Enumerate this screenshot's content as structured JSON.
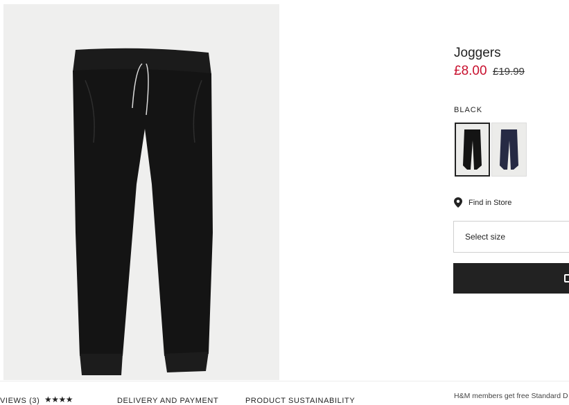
{
  "product": {
    "title": "Joggers",
    "price": "£8.00",
    "old_price": "£19.99",
    "color_label": "BLACK",
    "swatches": [
      {
        "name": "black",
        "color": "#141414",
        "selected": true
      },
      {
        "name": "navy",
        "color": "#262a44",
        "selected": false
      }
    ],
    "find_in_store": "Find in Store",
    "size_select_label": "Select size"
  },
  "colors": {
    "sale": "#c8102e",
    "button": "#222222"
  },
  "bottom_bar": {
    "reviews_label": "VIEWS (3)",
    "rating_stars": "★★★★",
    "rating": 4.5,
    "delivery_label": "DELIVERY AND PAYMENT",
    "sustainability_label": "PRODUCT SUSTAINABILITY",
    "members_text": "H&M members get free Standard D"
  }
}
